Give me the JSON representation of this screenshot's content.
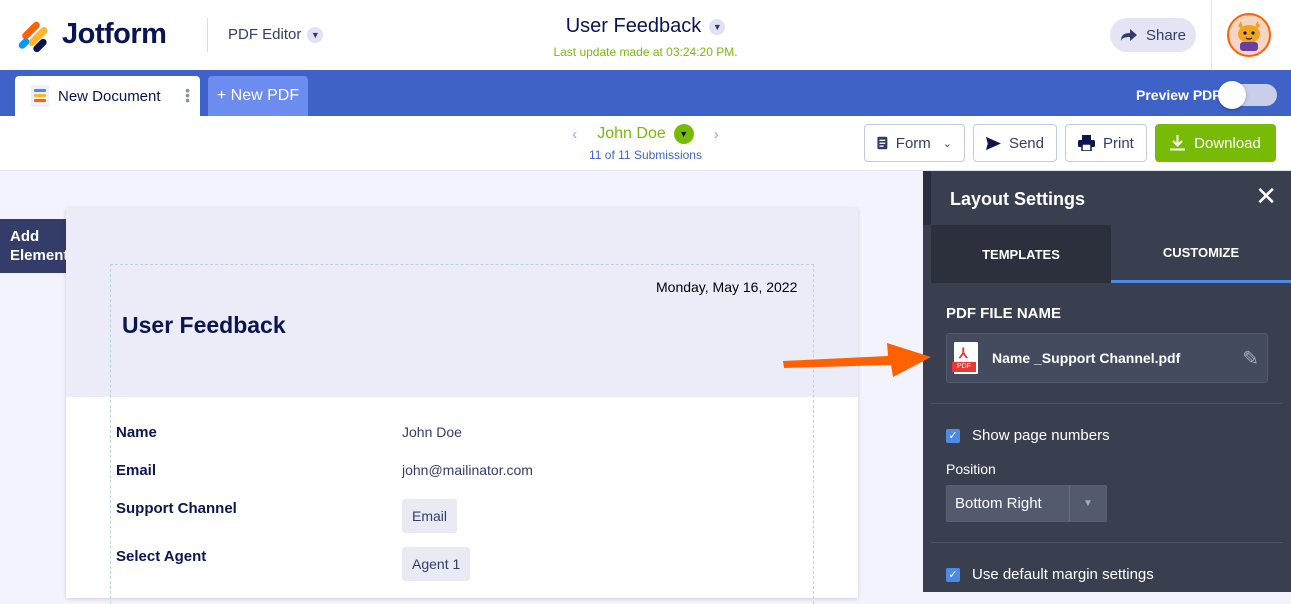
{
  "header": {
    "brand": "Jotform",
    "app_name": "PDF Editor",
    "doc_title": "User Feedback",
    "last_update": "Last update made at 03:24:20 PM.",
    "share_label": "Share"
  },
  "tabs": {
    "active_label": "New Document",
    "new_pdf_label": "+ New PDF",
    "preview_label": "Preview PDF",
    "preview_on": false
  },
  "toolbar": {
    "submitter": "John Doe",
    "submissions": "11 of 11 Submissions",
    "form_label": "Form",
    "send_label": "Send",
    "print_label": "Print",
    "download_label": "Download"
  },
  "canvas": {
    "add_element_line1": "Add",
    "add_element_line2": "Element",
    "date": "Monday, May 16, 2022",
    "title": "User Feedback",
    "fields": [
      {
        "label": "Name",
        "value": "John Doe"
      },
      {
        "label": "Email",
        "value": "john@mailinator.com"
      },
      {
        "label": "Support Channel",
        "value": "Email"
      },
      {
        "label": "Select Agent",
        "value": "Agent 1"
      }
    ]
  },
  "panel": {
    "title": "Layout Settings",
    "tab_templates": "TEMPLATES",
    "tab_customize": "CUSTOMIZE",
    "file_name_label": "PDF FILE NAME",
    "file_name": "Name _Support Channel.pdf",
    "show_page_numbers": "Show page numbers",
    "position_label": "Position",
    "position_value": "Bottom Right",
    "default_margin": "Use default margin settings"
  },
  "colors": {
    "brand_blue": "#3e62c8",
    "accent_green": "#78bb07",
    "arrow_orange": "#ff6100",
    "panel_bg": "#3a3f4f"
  }
}
